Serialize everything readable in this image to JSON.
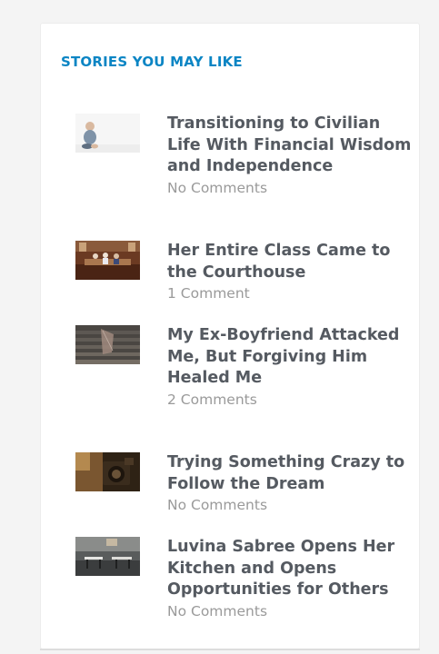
{
  "widget": {
    "title": "STORIES YOU MAY LIKE",
    "accent_color": "#0b85c4"
  },
  "stories": [
    {
      "title": "Transitioning to Civilian Life With Financial Wisdom and Independence",
      "comments": "No Comments",
      "thumbnail": "toddler-sitting-photo"
    },
    {
      "title": "Her Entire Class Came to the Courthouse",
      "comments": "1 Comment",
      "thumbnail": "courtroom-photo"
    },
    {
      "title": "My Ex-Boyfriend Attacked Me, But Forgiving Him Healed Me",
      "comments": "2 Comments",
      "thumbnail": "stairs-photo"
    },
    {
      "title": "Trying Something Crazy to Follow the Dream",
      "comments": "No Comments",
      "thumbnail": "vintage-camera-photo"
    },
    {
      "title": "Luvina Sabree Opens Her Kitchen and Opens Opportunities for Others",
      "comments": "No Comments",
      "thumbnail": "restaurant-interior-photo"
    }
  ]
}
